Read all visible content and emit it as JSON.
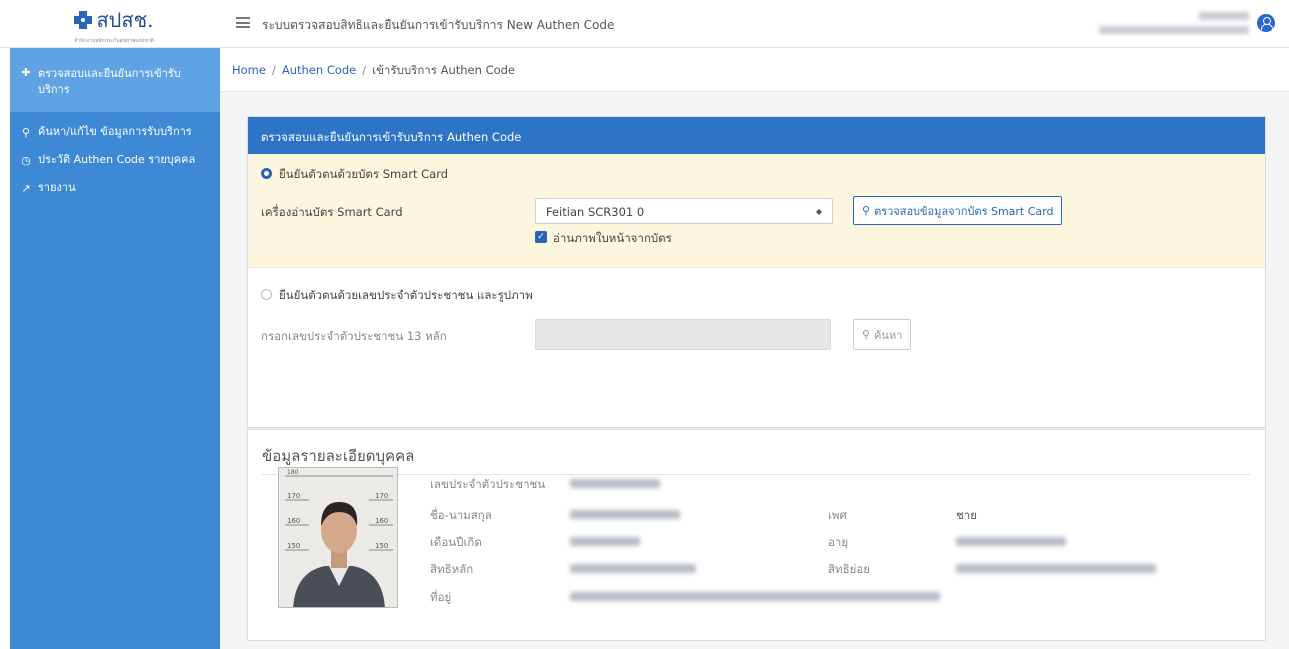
{
  "header": {
    "logo_text": "สปสช.",
    "logo_sub": "สำนักงานหลักประกันสุขภาพแห่งชาติ",
    "app_title": "ระบบตรวจสอบสิทธิและยืนยันการเข้ารับบริการ New Authen Code",
    "menu_icon": "hamburger-icon",
    "user_icon": "user-circle-icon"
  },
  "sidebar": {
    "items": [
      {
        "icon": "plus-icon",
        "label": "ตรวจสอบและยืนยันการเข้ารับบริการ"
      },
      {
        "icon": "search-icon",
        "label": "ค้นหา/แก้ไข ข้อมูลการรับบริการ"
      },
      {
        "icon": "history-icon",
        "label": "ประวัติ Authen Code รายบุคคล"
      },
      {
        "icon": "chart-icon",
        "label": "รายงาน"
      }
    ]
  },
  "breadcrumb": [
    "Home",
    "Authen Code",
    "เข้ารับบริการ Authen Code"
  ],
  "verify_card": {
    "title": "ตรวจสอบและยืนยันการเข้ารับบริการ Authen Code",
    "smart_card": {
      "option_label": "ยืนยันตัวตนด้วยบัตร Smart Card",
      "reader_label": "เครื่องอ่านบัตร Smart Card",
      "reader_value": "Feitian SCR301 0",
      "photo_checkbox_label": "อ่านภาพใบหน้าจากบัตร",
      "check_button": "ตรวจสอบข้อมูลจากบัตร Smart Card"
    },
    "id_number": {
      "option_label": "ยืนยันตัวตนด้วยเลขประจำตัวประชาชน และรูปภาพ",
      "input_label": "กรอกเลขประจำตัวประชาชน 13 หลัก",
      "search_button": "ค้นหา"
    }
  },
  "person_card": {
    "title": "ข้อมูลรายละเอียดบุคคล",
    "labels": {
      "id": "เลขประจำตัวประชาชน",
      "name": "ชื่อ-นามสกุล",
      "birth": "เดือนปีเกิด",
      "main_right": "สิทธิหลัก",
      "address": "ที่อยู่",
      "sex": "เพศ",
      "age": "อายุ",
      "sub_right": "สิทธิย่อย"
    },
    "sex_value": "ชาย",
    "photo_scale": [
      "180",
      "170",
      "160",
      "150"
    ]
  },
  "colors": {
    "sidebar": "#3d89d6",
    "sidebar_active": "#5fa3e4",
    "header_blue": "#2d74c6",
    "highlight": "#fcf6df"
  }
}
